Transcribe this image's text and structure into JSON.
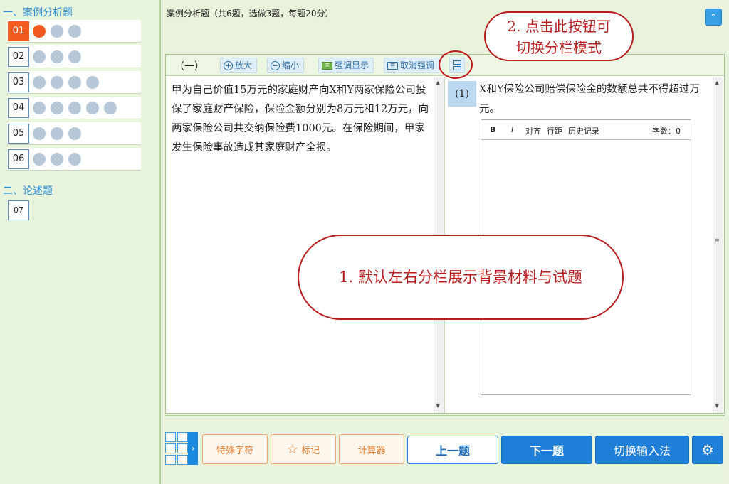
{
  "sidebar": {
    "section1": "一、案例分析题",
    "section2": "二、论述题",
    "questions": [
      {
        "num": "01",
        "dots": 3,
        "done": 1,
        "active": true
      },
      {
        "num": "02",
        "dots": 3,
        "done": 0
      },
      {
        "num": "03",
        "dots": 4,
        "done": 0
      },
      {
        "num": "04",
        "dots": 5,
        "done": 0
      },
      {
        "num": "05",
        "dots": 3,
        "done": 0
      },
      {
        "num": "06",
        "dots": 3,
        "done": 0
      }
    ],
    "question7": "07"
  },
  "header": {
    "text": "案例分析题（共6题，选做3题，每题20分）",
    "collapse_icon": "double-chevron-up-icon"
  },
  "toolbar": {
    "part_label": "（一）",
    "zoom_in": "放大",
    "zoom_out": "缩小",
    "highlight": "强调显示",
    "unhighlight": "取消强调",
    "split_icon": "split-layout-icon"
  },
  "material": {
    "text": "甲为自己价值15万元的家庭财产向X和Y两家保险公司投保了家庭财产保险，保险金额分别为8万元和12万元，向两家保险公司共交纳保险费1000元。在保险期间，甲家发生保险事故造成其家庭财产全损。"
  },
  "question": {
    "tag": "(1)",
    "text": "X和Y保险公司赔偿保险金的数额总共不得超过万元。"
  },
  "editor": {
    "bold": "B",
    "italic": "I",
    "align": "对齐",
    "line_spacing": "行距",
    "history": "历史记录",
    "word_count": "字数：0"
  },
  "bottom": {
    "special_chars": "特殊字符",
    "mark": "标记",
    "calculator": "计算器",
    "prev": "上一题",
    "next": "下一题",
    "switch_ime": "切换输入法",
    "settings_icon": "gear-icon"
  },
  "callouts": {
    "callout1": "1. 默认左右分栏展示背景材料与试题",
    "callout2_line1": "2. 点击此按钮可",
    "callout2_line2": "切换分栏模式"
  }
}
